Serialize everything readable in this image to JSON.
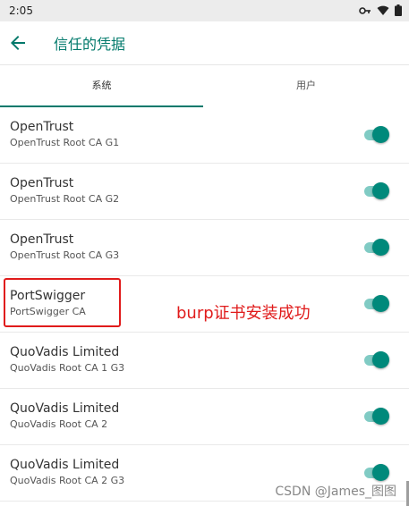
{
  "status_bar": {
    "time": "2:05",
    "icons": [
      "key-icon",
      "wifi-icon",
      "battery-icon"
    ]
  },
  "app_bar": {
    "title": "信任的凭据",
    "back_icon": "arrow-back-icon"
  },
  "tabs": [
    {
      "label": "系统",
      "selected": true
    },
    {
      "label": "用户",
      "selected": false
    }
  ],
  "certificates": [
    {
      "title": "OpenTrust",
      "subtitle": "OpenTrust Root CA G1",
      "enabled": true
    },
    {
      "title": "OpenTrust",
      "subtitle": "OpenTrust Root CA G2",
      "enabled": true
    },
    {
      "title": "OpenTrust",
      "subtitle": "OpenTrust Root CA G3",
      "enabled": true
    },
    {
      "title": "PortSwigger",
      "subtitle": "PortSwigger CA",
      "enabled": true
    },
    {
      "title": "QuoVadis Limited",
      "subtitle": "QuoVadis Root CA 1 G3",
      "enabled": true
    },
    {
      "title": "QuoVadis Limited",
      "subtitle": "QuoVadis Root CA 2",
      "enabled": true
    },
    {
      "title": "QuoVadis Limited",
      "subtitle": "QuoVadis Root CA 2 G3",
      "enabled": true
    }
  ],
  "annotation": "burp证书安装成功",
  "watermark": "CSDN @James_图图",
  "colors": {
    "accent": "#00796b",
    "switch_thumb": "#00897b",
    "switch_track": "#80cbc4",
    "annotation_red": "#e01b1b"
  }
}
